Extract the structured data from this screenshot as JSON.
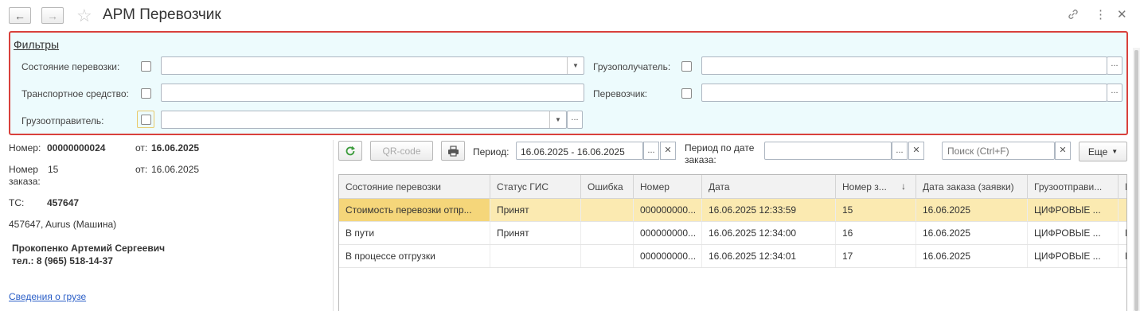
{
  "window": {
    "title": "АРМ Перевозчик",
    "icons": [
      "back-icon",
      "forward-icon",
      "star-icon",
      "link-icon",
      "more-icon",
      "close-icon"
    ]
  },
  "filters": {
    "header": "Фильтры",
    "state_label": "Состояние перевозки:",
    "vehicle_label": "Транспортное средство:",
    "shipper_label": "Грузоотправитель:",
    "consignee_label": "Грузополучатель:",
    "carrier_label": "Перевозчик:",
    "state_value": "",
    "vehicle_value": "",
    "shipper_value": "",
    "consignee_value": "",
    "carrier_value": ""
  },
  "details": {
    "number_label": "Номер:",
    "number_value": "00000000024",
    "from_label": "от:",
    "from_value": "16.06.2025",
    "order_number_label": "Номер заказа:",
    "order_number_value": "15",
    "order_from_label": "от:",
    "order_from_value": "16.06.2025",
    "vehicle_label": "ТС:",
    "vehicle_value": "457647",
    "vehicle_desc": "457647, Aurus (Машина)",
    "driver_name": "Прокопенко Артемий Сергеевич",
    "driver_phone": "тел.: 8 (965) 518-14-37",
    "cargo_link": "Сведения о грузе"
  },
  "toolbar": {
    "qr_label": "QR-code",
    "period_label": "Период:",
    "period_value": "16.06.2025 - 16.06.2025",
    "order_period_label_1": "Период по дате",
    "order_period_label_2": "заказа:",
    "order_period_value": "",
    "search_placeholder": "Поиск (Ctrl+F)",
    "more_label": "Еще"
  },
  "table": {
    "columns": [
      "Состояние перевозки",
      "Статус ГИС",
      "Ошибка",
      "Номер",
      "Дата",
      "Номер з...",
      "Дата заказа (заявки)",
      "Грузоотправи...",
      "Г"
    ],
    "rows": [
      [
        "Стоимость перевозки отпр...",
        "Принят",
        "",
        "000000000...",
        "16.06.2025 12:33:59",
        "15",
        "16.06.2025",
        "ЦИФРОВЫЕ ...",
        ""
      ],
      [
        "В пути",
        "Принят",
        "",
        "000000000...",
        "16.06.2025 12:34:00",
        "16",
        "16.06.2025",
        "ЦИФРОВЫЕ ...",
        "L"
      ],
      [
        "В процессе отгрузки",
        "",
        "",
        "000000000...",
        "16.06.2025 12:34:01",
        "17",
        "16.06.2025",
        "ЦИФРОВЫЕ ...",
        "L"
      ]
    ],
    "sort_column": "Номер з...",
    "sort_direction": "descending"
  },
  "colors": {
    "filter_bg": "#edfbfd",
    "filter_border": "#d9413c",
    "selected_row": "#fbeab1",
    "link": "#2a5ec7",
    "refresh_icon": "#3a9b3a"
  }
}
